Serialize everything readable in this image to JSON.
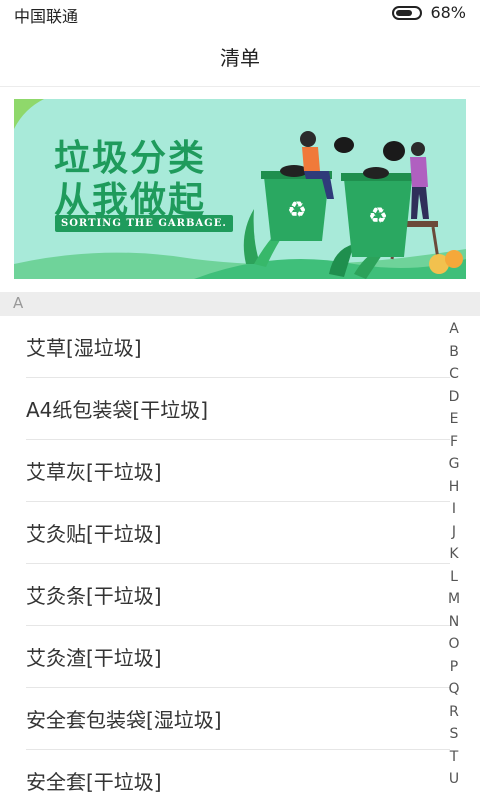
{
  "status_bar": {
    "carrier": "中国联通",
    "battery": "68%",
    "battery_level": 0.68
  },
  "header": {
    "title": "清单"
  },
  "banner": {
    "title_line1": "垃圾分类",
    "title_line2": "从我做起",
    "tagline": "SORTING THE GARBAGE."
  },
  "section": {
    "letter": "A"
  },
  "items": [
    {
      "label": "艾草[湿垃圾]"
    },
    {
      "label": "A4纸包装袋[干垃圾]"
    },
    {
      "label": "艾草灰[干垃圾]"
    },
    {
      "label": "艾灸贴[干垃圾]"
    },
    {
      "label": "艾灸条[干垃圾]"
    },
    {
      "label": "艾灸渣[干垃圾]"
    },
    {
      "label": "安全套包装袋[湿垃圾]"
    },
    {
      "label": "安全套[干垃圾]"
    }
  ],
  "index_letters": [
    "A",
    "B",
    "C",
    "D",
    "E",
    "F",
    "G",
    "H",
    "I",
    "J",
    "K",
    "L",
    "M",
    "N",
    "O",
    "P",
    "Q",
    "R",
    "S",
    "T",
    "U"
  ],
  "colors": {
    "banner_bg": "#a8ead9",
    "brand_green": "#1f9b5c",
    "bin_green": "#2aa861"
  }
}
